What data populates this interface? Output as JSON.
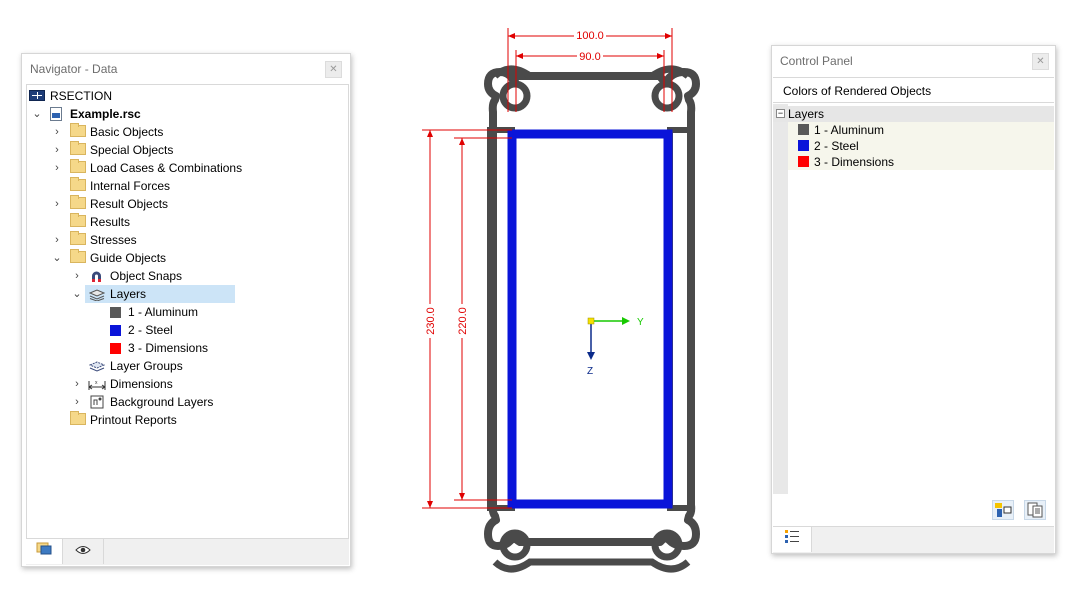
{
  "navigator": {
    "title": "Navigator - Data",
    "root_label": "RSECTION",
    "file_label": "Example.rsc",
    "items": [
      {
        "label": "Basic Objects",
        "expandable": true
      },
      {
        "label": "Special Objects",
        "expandable": true
      },
      {
        "label": "Load Cases & Combinations",
        "expandable": true
      },
      {
        "label": "Internal Forces",
        "expandable": false
      },
      {
        "label": "Result Objects",
        "expandable": true
      },
      {
        "label": "Results",
        "expandable": false
      },
      {
        "label": "Stresses",
        "expandable": true
      },
      {
        "label": "Guide Objects",
        "expandable": true,
        "expanded": true
      }
    ],
    "guide_children": {
      "object_snaps": "Object Snaps",
      "layers": "Layers",
      "layer_groups": "Layer Groups",
      "dimensions": "Dimensions",
      "background_layers": "Background Layers"
    },
    "layers": [
      {
        "label": "1 - Aluminum",
        "color": "#595959"
      },
      {
        "label": "2 - Steel",
        "color": "#0a14d9"
      },
      {
        "label": "3 - Dimensions",
        "color": "#ff0000"
      }
    ],
    "printout_reports": "Printout Reports"
  },
  "drawing": {
    "dim_top_outer": "100.0",
    "dim_top_inner": "90.0",
    "dim_left_outer": "230.0",
    "dim_left_inner": "220.0",
    "axis_y": "Y",
    "axis_z": "Z",
    "colors": {
      "aluminum": "#4a4a4a",
      "steel": "#0a14d9",
      "dimension": "#e00000",
      "axis_y": "#17c900",
      "axis_z": "#0a2a8a",
      "origin": "#f5e100"
    }
  },
  "control_panel": {
    "title": "Control Panel",
    "header": "Colors of Rendered Objects",
    "group_label": "Layers",
    "layers": [
      {
        "label": "1 - Aluminum",
        "color": "#595959"
      },
      {
        "label": "2 - Steel",
        "color": "#0a14d9"
      },
      {
        "label": "3 - Dimensions",
        "color": "#ff0000"
      }
    ]
  }
}
